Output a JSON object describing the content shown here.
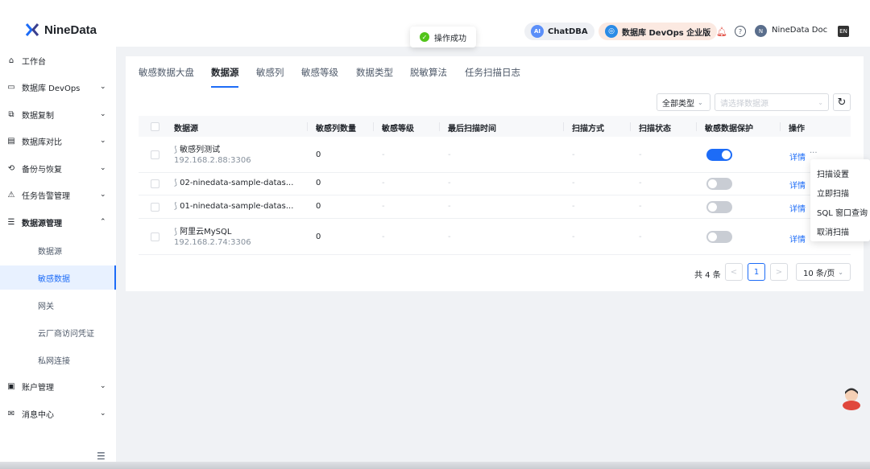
{
  "brand": {
    "name": "NineData"
  },
  "toast": {
    "text": "操作成功"
  },
  "topnav": {
    "chatdba": "ChatDBA",
    "devops": "数据库 DevOps 企业版",
    "doc": "NineData Doc"
  },
  "sidebar": {
    "items": [
      {
        "label": "工作台"
      },
      {
        "label": "数据库 DevOps"
      },
      {
        "label": "数据复制"
      },
      {
        "label": "数据库对比"
      },
      {
        "label": "备份与恢复"
      },
      {
        "label": "任务告警管理"
      },
      {
        "label": "数据源管理"
      },
      {
        "label": "数据源"
      },
      {
        "label": "敏感数据"
      },
      {
        "label": "网关"
      },
      {
        "label": "云厂商访问凭证"
      },
      {
        "label": "私网连接"
      },
      {
        "label": "账户管理"
      },
      {
        "label": "消息中心"
      }
    ]
  },
  "tabs": [
    "敏感数据大盘",
    "数据源",
    "敏感列",
    "敏感等级",
    "数据类型",
    "脱敏算法",
    "任务扫描日志"
  ],
  "filters": {
    "type": "全部类型",
    "datasource_placeholder": "请选择数据源"
  },
  "table": {
    "headers": [
      "数据源",
      "敏感列数量",
      "敏感等级",
      "最后扫描时间",
      "扫描方式",
      "扫描状态",
      "敏感数据保护",
      "操作"
    ],
    "rows": [
      {
        "name": "敏感列测试",
        "address": "192.168.2.88:3306",
        "count": "0",
        "level": "-",
        "last_scan": "-",
        "mode": "-",
        "status": "-",
        "protect": true,
        "action": "详情",
        "more": "···"
      },
      {
        "name": "02-ninedata-sample-datas...",
        "address": "",
        "count": "0",
        "level": "-",
        "last_scan": "-",
        "mode": "-",
        "status": "-",
        "protect": false,
        "action": "详情",
        "more": ""
      },
      {
        "name": "01-ninedata-sample-datas...",
        "address": "",
        "count": "0",
        "level": "-",
        "last_scan": "-",
        "mode": "-",
        "status": "-",
        "protect": false,
        "action": "详情",
        "more": ""
      },
      {
        "name": "阿里云MySQL",
        "address": "192.168.2.74:3306",
        "count": "0",
        "level": "-",
        "last_scan": "-",
        "mode": "-",
        "status": "-",
        "protect": false,
        "action": "详情",
        "more": ""
      }
    ]
  },
  "context_menu": [
    "扫描设置",
    "立即扫描",
    "SQL 窗口查询",
    "取消扫描"
  ],
  "pagination": {
    "total": "共 4 条",
    "prev": "<",
    "page": "1",
    "next": ">",
    "size": "10 条/页"
  },
  "colors": {
    "accent": "#1d6cf7",
    "success": "#52c41a"
  }
}
